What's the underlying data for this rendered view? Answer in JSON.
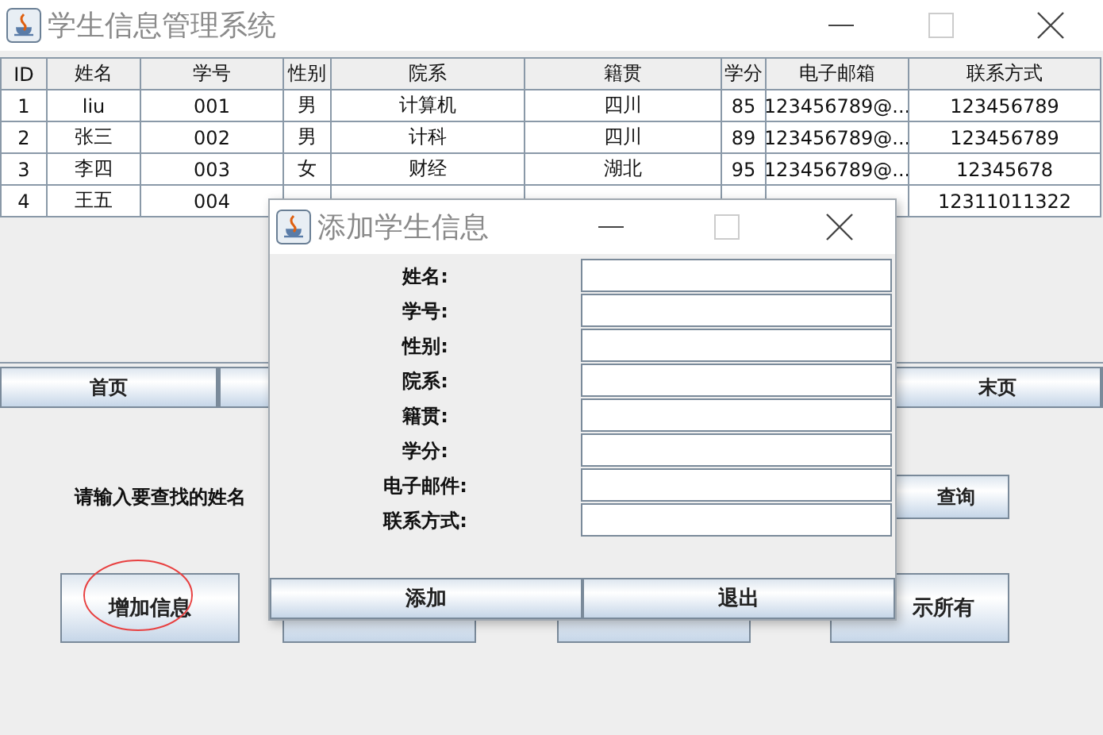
{
  "window": {
    "title": "学生信息管理系统"
  },
  "table": {
    "columns": [
      "ID",
      "姓名",
      "学号",
      "性别",
      "院系",
      "籍贯",
      "学分",
      "电子邮箱",
      "联系方式"
    ],
    "rows": [
      [
        "1",
        "liu",
        "001",
        "男",
        "计算机",
        "四川",
        "85",
        "123456789@...",
        "123456789"
      ],
      [
        "2",
        "张三",
        "002",
        "男",
        "计科",
        "四川",
        "89",
        "123456789@...",
        "123456789"
      ],
      [
        "3",
        "李四",
        "003",
        "女",
        "财经",
        "湖北",
        "95",
        "123456789@...",
        "12345678"
      ],
      [
        "4",
        "王五",
        "004",
        null,
        null,
        null,
        null,
        null,
        "12311011322"
      ]
    ]
  },
  "nav_buttons": [
    {
      "kind": "text",
      "label": "首页"
    },
    {
      "kind": "blank"
    },
    {
      "kind": "text",
      "label": "末页"
    }
  ],
  "search": {
    "label": "请输入要查找的姓名",
    "button": "查询"
  },
  "action_buttons": [
    {
      "label": "增加信息",
      "highlighted": true
    },
    {
      "highlighted": false
    },
    {
      "highlighted": false
    },
    {
      "label": "示所有",
      "highlighted": false
    }
  ],
  "dialog": {
    "title": "添加学生信息",
    "fields": [
      {
        "label": "姓名:"
      },
      {
        "label": "学号:"
      },
      {
        "label": "性别:"
      },
      {
        "label": "院系:"
      },
      {
        "label": "籍贯:"
      },
      {
        "label": "学分:"
      },
      {
        "label": "电子邮件:"
      },
      {
        "label": "联系方式:"
      }
    ],
    "buttons": [
      "添加",
      "退出"
    ]
  }
}
